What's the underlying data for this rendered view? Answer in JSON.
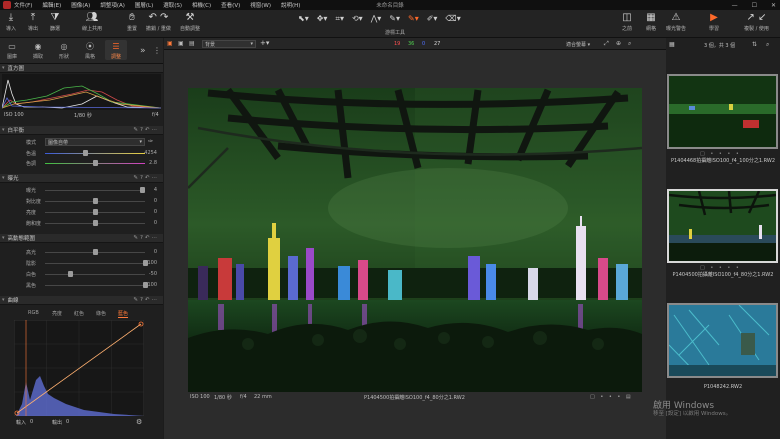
{
  "menubar": {
    "items": [
      "文件(F)",
      "編輯(E)",
      "圖像(A)",
      "調整項(A)",
      "圖層(L)",
      "選取(S)",
      "相機(C)",
      "查看(V)",
      "視窗(W)",
      "說明(H)"
    ],
    "window_title": "未命名目錄"
  },
  "toolbar": {
    "import": "導入",
    "export": "導出",
    "filter": "篩選",
    "share": "線上共用",
    "reset": "重置",
    "undo_redo": "撤銷 / 重做",
    "auto_adjust": "自動調整",
    "cursor_tools": "游標工具",
    "back": "之前",
    "grid": "網格",
    "exposure_warning": "曝光警告",
    "learn": "學習",
    "copy_apply": "複製 / 使用"
  },
  "left_tabs": [
    "圖庫",
    "擷取",
    "形狀",
    "風格",
    "調整"
  ],
  "histogram": {
    "title": "直方圖",
    "iso": "ISO 100",
    "shutter": "1/80 秒",
    "aperture": "f/4"
  },
  "white_balance": {
    "title": "白平衡",
    "mode_label": "模式",
    "mode_value": "圖像自帶",
    "temp_label": "色溫",
    "temp_value": "4254",
    "tint_label": "色調",
    "tint_value": "2.8",
    "temp_fraction": 0.4,
    "tint_fraction": 0.5
  },
  "exposure": {
    "title": "曝光",
    "rows": [
      {
        "label": "曝光",
        "value": "4",
        "fraction": 0.97
      },
      {
        "label": "對比度",
        "value": "0",
        "fraction": 0.5
      },
      {
        "label": "亮度",
        "value": "0",
        "fraction": 0.5
      },
      {
        "label": "飽和度",
        "value": "0",
        "fraction": 0.5
      }
    ]
  },
  "hdr": {
    "title": "高動態範圍",
    "rows": [
      {
        "label": "高光",
        "value": "0",
        "fraction": 0.5
      },
      {
        "label": "陰影",
        "value": "100",
        "fraction": 1.0
      },
      {
        "label": "白色",
        "value": "-50",
        "fraction": 0.25
      },
      {
        "label": "黑色",
        "value": "100",
        "fraction": 1.0
      }
    ]
  },
  "curve": {
    "title": "曲線",
    "channels": [
      "RGB",
      "亮度",
      "紅色",
      "綠色",
      "藍色"
    ],
    "active_channel": "藍色",
    "input_label": "輸入",
    "input_value": "0",
    "output_label": "輸出",
    "output_value": "0"
  },
  "viewer_bar": {
    "preset": "背景",
    "count_red": "19",
    "count_green": "36",
    "count_blue": "0",
    "count_white": "27",
    "fit": "適合螢幕"
  },
  "viewer_info": {
    "iso": "ISO 100",
    "shutter": "1/80 秒",
    "aperture": "f/4",
    "focal": "22 mm",
    "filename": "P1404500拍攝離ISO100_f4_80分之1.RW2"
  },
  "browser": {
    "count": "3 個，共 3 個",
    "thumbs": [
      {
        "caption": "P1404468拍攝離ISO100_f4_100分之1.RW2"
      },
      {
        "caption": "P1404500拍攝離ISO100_f4_80分之1.RW2"
      },
      {
        "caption": "P1048242.RW2"
      }
    ]
  },
  "watermark": {
    "line1": "啟用 Windows",
    "line2": "移至 [設定] 以啟用 Windows。"
  },
  "colors": {
    "accent": "#ff6a2a",
    "photo_green": "#1e5a1e"
  }
}
